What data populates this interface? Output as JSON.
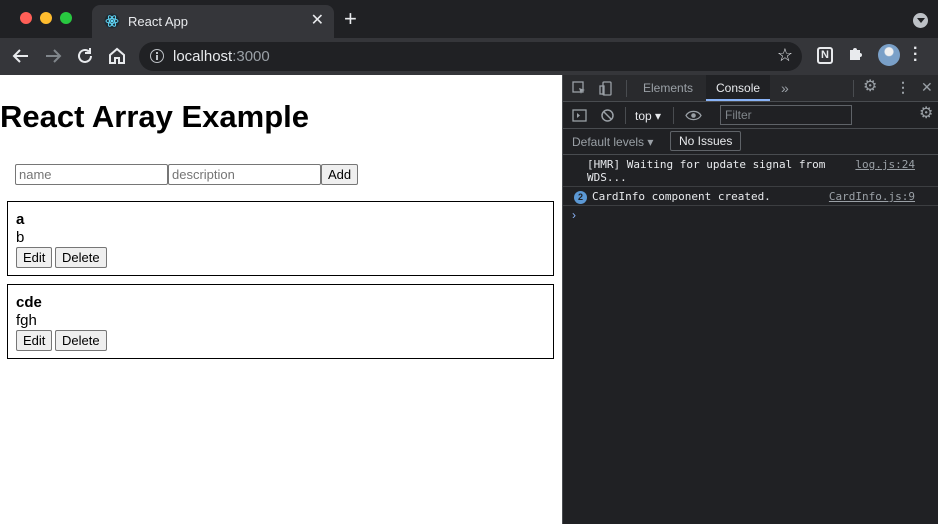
{
  "browser": {
    "tab_title": "React App",
    "close_glyph": "✕",
    "new_tab_glyph": "+",
    "url_host": "localhost",
    "url_port": ":3000",
    "extension_n": "N",
    "icons": [
      "back-icon",
      "forward-icon",
      "reload-icon",
      "home-icon",
      "info-icon",
      "star-icon",
      "notion-icon",
      "puzzle-icon",
      "avatar",
      "menu-icon"
    ]
  },
  "page": {
    "heading": "React Array Example",
    "name_placeholder": "name",
    "description_placeholder": "description",
    "add_label": "Add",
    "items": [
      {
        "name": "a",
        "description": "b",
        "edit_label": "Edit",
        "delete_label": "Delete"
      },
      {
        "name": "cde",
        "description": "fgh",
        "edit_label": "Edit",
        "delete_label": "Delete"
      }
    ]
  },
  "devtools": {
    "tabs": [
      "Elements",
      "Console"
    ],
    "active_tab": "Console",
    "context": "top",
    "filter_placeholder": "Filter",
    "levels": "Default levels ▾",
    "issues": "No Issues",
    "logs": [
      {
        "message_line1": "[HMR] Waiting for update signal from",
        "message_line2": "WDS...",
        "source": "log.js:24"
      },
      {
        "count": "2",
        "message": "CardInfo component created.",
        "source": "CardInfo.js:9"
      }
    ],
    "prompt": "›"
  }
}
